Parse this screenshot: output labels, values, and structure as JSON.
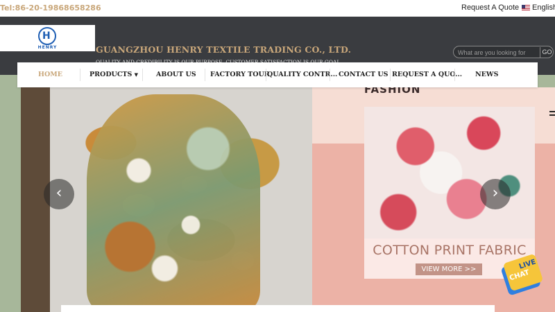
{
  "topbar": {
    "tel": "Tel:86-20-19868658286",
    "request_quote": "Request A Quote",
    "language": "English"
  },
  "header": {
    "logo_text": "HENRY",
    "company_name": "GUANGZHOU HENRY TEXTILE TRADING CO., LTD.",
    "slogan": "QUALITY AND CREDIBILITY IS OUR PURPOSE, CUSTOMER SATISFACTION IS OUR GOAL.",
    "search_placeholder": "What are you looking for",
    "search_button": "GO"
  },
  "nav": {
    "items": [
      {
        "label": "HOME"
      },
      {
        "label": "PRODUCTS"
      },
      {
        "label": "ABOUT US"
      },
      {
        "label": "FACTORY TOUR"
      },
      {
        "label": "QUALITY CONTR..."
      },
      {
        "label": "CONTACT US"
      },
      {
        "label": "REQUEST A QUO..."
      },
      {
        "label": "NEWS"
      }
    ]
  },
  "hero": {
    "fashion_label": "FASHION",
    "fabric_title": "COTTON PRINT FABRIC",
    "view_more": "VIEW MORE >>",
    "prev_arrow": "‹",
    "next_arrow": "›"
  },
  "live_chat": {
    "line1": "LIVE",
    "line2": "CHAT"
  },
  "colors": {
    "accent": "#c9a77a",
    "header_bg": "#3a3c40",
    "logo_blue": "#1f5fb4"
  }
}
